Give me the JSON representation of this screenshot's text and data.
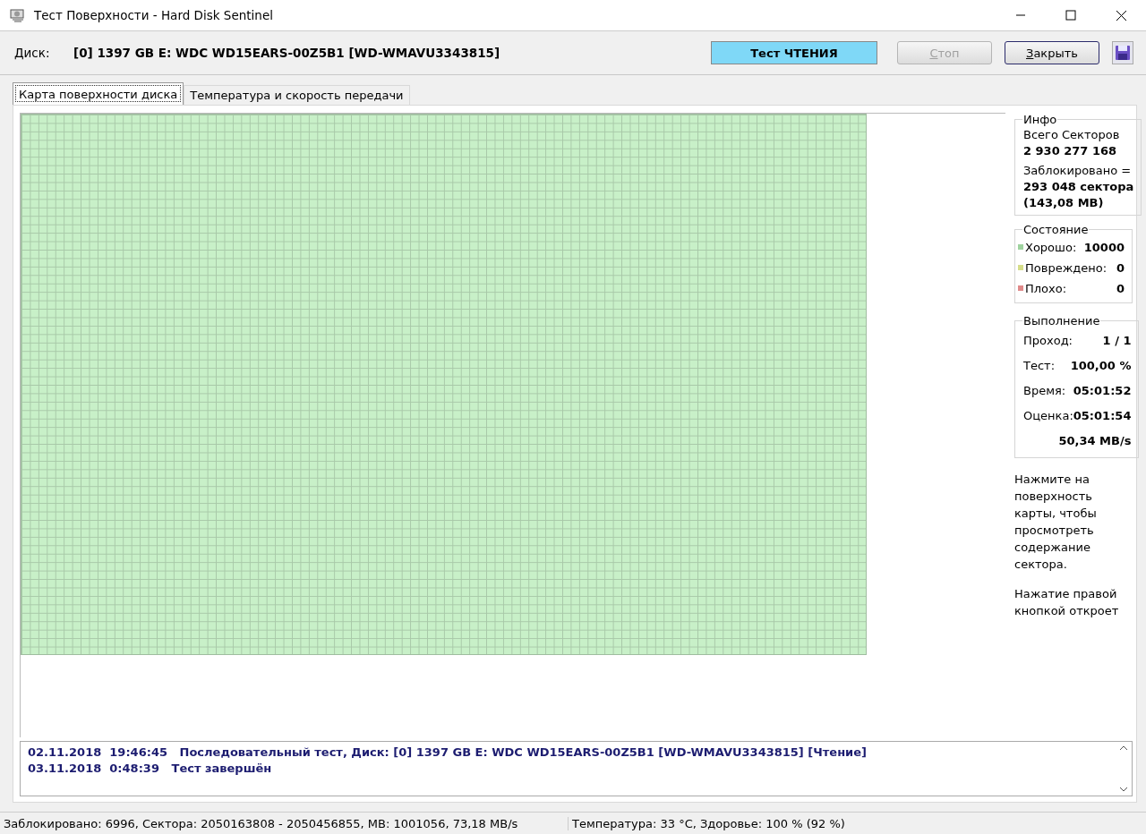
{
  "window": {
    "title": "Тест Поверхности - Hard Disk Sentinel"
  },
  "toolbar": {
    "disk_label": "Диск:",
    "disk_value": "[0] 1397 GB E: WDC WD15EARS-00Z5B1 [WD-WMAVU3343815]",
    "test_mode": "Тест ЧТЕНИЯ",
    "buttons": [
      {
        "label": "Стоп",
        "disabled": true,
        "mnemonic": true
      },
      {
        "label": "Закрыть",
        "disabled": false,
        "mnemonic": true
      }
    ]
  },
  "tabs": [
    {
      "label": "Карта поверхности диска",
      "selected": true
    },
    {
      "label": "Температура и скорость передачи",
      "selected": false
    }
  ],
  "info": {
    "title": "Инфо",
    "total_label": "Всего Секторов",
    "total_value": "2 930 277 168",
    "blocked_label": "Заблокировано =",
    "blocked_value": "293 048 сектора",
    "blocked_size": "(143,08 MB)"
  },
  "state": {
    "title": "Состояние",
    "items": [
      {
        "label": "Хорошо:",
        "value": "10000",
        "color": "#9fd39f"
      },
      {
        "label": "Повреждено:",
        "value": "0",
        "color": "#d6de8a"
      },
      {
        "label": "Плохо:",
        "value": "0",
        "color": "#e08a8a"
      }
    ]
  },
  "progress": {
    "title": "Выполнение",
    "rows": [
      {
        "label": "Проход:",
        "value": "1 / 1"
      },
      {
        "label": "Тест:",
        "value": "100,00 %"
      },
      {
        "label": "Время:",
        "value": "05:01:52"
      },
      {
        "label": "Оценка:",
        "value": "05:01:54"
      },
      {
        "label": "",
        "value": "50,34 MB/s"
      }
    ]
  },
  "hints": [
    "Нажмите на поверхность карты, чтобы просмотреть содержание сектора.",
    "Нажатие правой кнопкой откроет"
  ],
  "log": [
    {
      "date": "02.11.2018",
      "time": "19:46:45",
      "message": "Последовательный тест, Диск: [0] 1397 GB E: WDC WD15EARS-00Z5B1 [WD-WMAVU3343815] [Чтение]"
    },
    {
      "date": "03.11.2018",
      "time": "0:48:39",
      "message": "Тест завершён"
    }
  ],
  "status_bar": [
    "Заблокировано: 6996, Сектора: 2050163808 - 2050456855, MB: 1001056, 73,18 MB/s",
    "Температура: 33  °C,  Здоровье: 100 % (92 %)"
  ]
}
